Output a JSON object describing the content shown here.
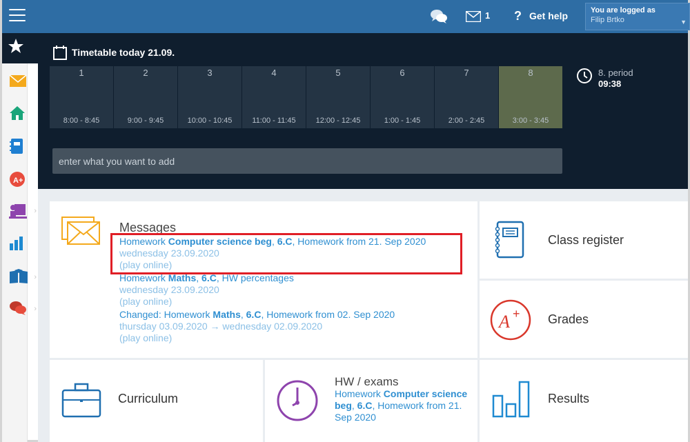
{
  "header": {
    "mail_count": "1",
    "help_label": "Get help",
    "login_status": "You are logged as",
    "user_name": "Filip Brtko"
  },
  "timetable": {
    "title": "Timetable today 21.09.",
    "periods": [
      {
        "num": "1",
        "time": "8:00 - 8:45"
      },
      {
        "num": "2",
        "time": "9:00 - 9:45"
      },
      {
        "num": "3",
        "time": "10:00 - 10:45"
      },
      {
        "num": "4",
        "time": "11:00 - 11:45"
      },
      {
        "num": "5",
        "time": "12:00 - 12:45"
      },
      {
        "num": "6",
        "time": "1:00 - 1:45"
      },
      {
        "num": "7",
        "time": "2:00 - 2:45"
      },
      {
        "num": "8",
        "time": "3:00 - 3:45"
      }
    ],
    "current_period_label": "8. period",
    "current_time": "09:38",
    "add_placeholder": "enter what you want to add"
  },
  "messages": {
    "title": "Messages",
    "items": [
      {
        "pre": "Homework ",
        "bold1": "Computer science beg",
        "mid": ", ",
        "bold2": "6.C",
        "post": ", Homework from 21. Sep 2020",
        "date": "wednesday 23.09.2020",
        "play": "(play online)"
      },
      {
        "pre": "Homework ",
        "bold1": "Maths",
        "mid": ", ",
        "bold2": "6.C",
        "post": ", HW percentages",
        "date": "wednesday 23.09.2020",
        "play": "(play online)"
      },
      {
        "pre": "Changed: Homework ",
        "bold1": "Maths",
        "mid": ", ",
        "bold2": "6.C",
        "post": ", Homework from 02. Sep 2020",
        "date": "thursday 03.09.2020 → wednesday 02.09.2020",
        "play": "(play online)"
      }
    ]
  },
  "tiles": {
    "class_register": "Class register",
    "grades": "Grades",
    "curriculum": "Curriculum",
    "results": "Results",
    "hw_title": "HW / exams",
    "hw_pre": "Homework ",
    "hw_bold1": "Computer science beg",
    "hw_mid": ", ",
    "hw_bold2": "6.C",
    "hw_post": ", Homework from 21. Sep 2020"
  },
  "colors": {
    "topbar": "#2e6da4",
    "dark": "#0f1e2e",
    "link": "#2f8fd1",
    "current_period": "#5d6a4c",
    "highlight": "#e01e26"
  }
}
